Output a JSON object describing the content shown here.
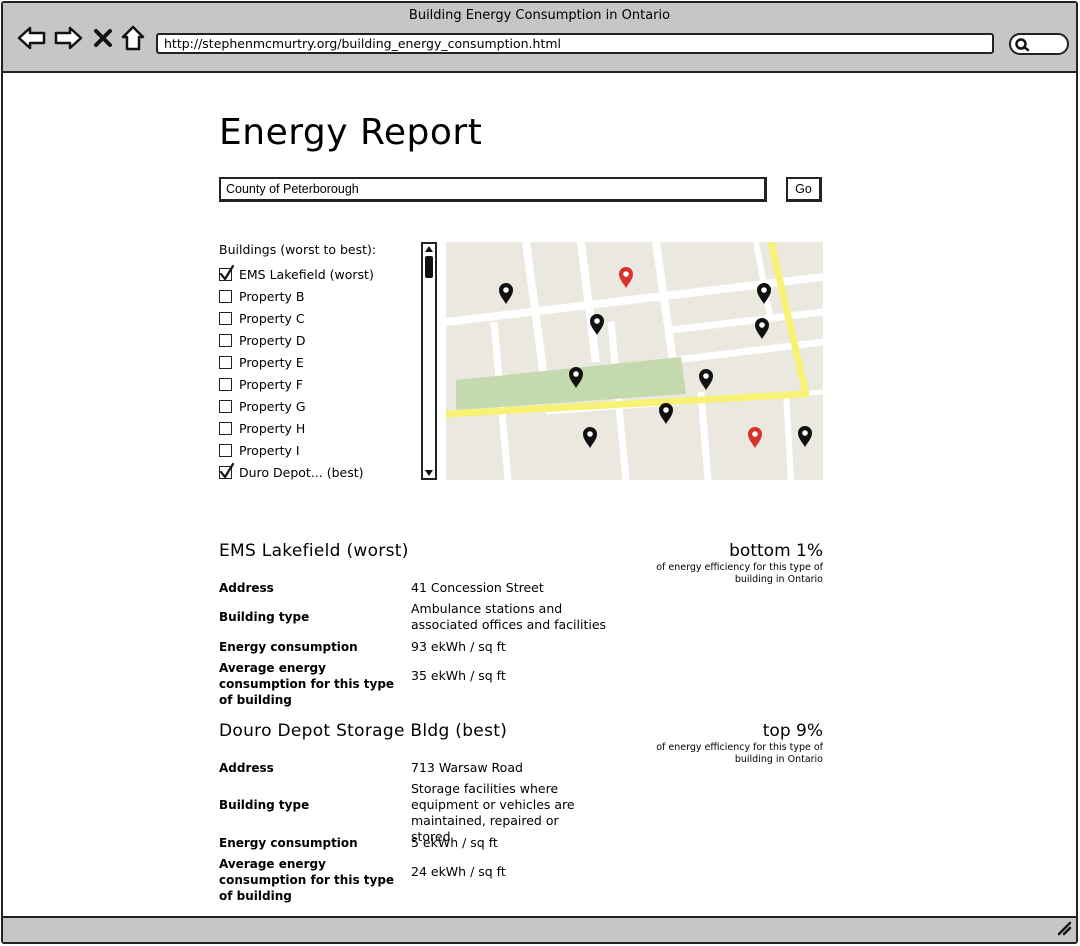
{
  "window": {
    "title": "Building Energy Consumption in Ontario",
    "url": "http://stephenmcmurtry.org/building_energy_consumption.html"
  },
  "page": {
    "title": "Energy Report",
    "location_input": "County of Peterborough",
    "go_label": "Go",
    "list_heading": "Buildings (worst to best):"
  },
  "buildings": [
    {
      "label": "EMS Lakefield (worst)",
      "checked": true
    },
    {
      "label": "Property B",
      "checked": false
    },
    {
      "label": "Property C",
      "checked": false
    },
    {
      "label": "Property D",
      "checked": false
    },
    {
      "label": "Property E",
      "checked": false
    },
    {
      "label": "Property F",
      "checked": false
    },
    {
      "label": "Property G",
      "checked": false
    },
    {
      "label": "Property H",
      "checked": false
    },
    {
      "label": "Property I",
      "checked": false
    },
    {
      "label": "Duro Depot... (best)",
      "checked": true
    }
  ],
  "map": {
    "colors": {
      "land": "#ebe8e0",
      "road": "#ffffff",
      "highway": "#f7f174",
      "park": "#c4d9ad",
      "pin": "#111111",
      "pin_selected": "#d8322d"
    }
  },
  "reports": [
    {
      "name": "EMS Lakefield (worst)",
      "rank": "bottom 1%",
      "rank_caption": "of energy efficiency for this type of building in Ontario",
      "fields": [
        {
          "key": "Address",
          "value": "41 Concession Street"
        },
        {
          "key": "Building type",
          "value": "Ambulance stations and associated offices and facilities"
        },
        {
          "key": "Energy consumption",
          "value": "93 ekWh / sq ft"
        },
        {
          "key": "Average energy consumption for this type of building",
          "value": "35 ekWh / sq ft"
        }
      ]
    },
    {
      "name": "Douro Depot Storage Bldg (best)",
      "rank": "top 9%",
      "rank_caption": "of energy efficiency for this type of building in Ontario",
      "fields": [
        {
          "key": "Address",
          "value": "713 Warsaw Road"
        },
        {
          "key": "Building type",
          "value": "Storage facilities where equipment or vehicles are maintained, repaired or stored"
        },
        {
          "key": "Energy consumption",
          "value": "5 ekWh / sq ft"
        },
        {
          "key": "Average energy consumption for this type of building",
          "value": "24 ekWh / sq ft"
        }
      ]
    }
  ]
}
